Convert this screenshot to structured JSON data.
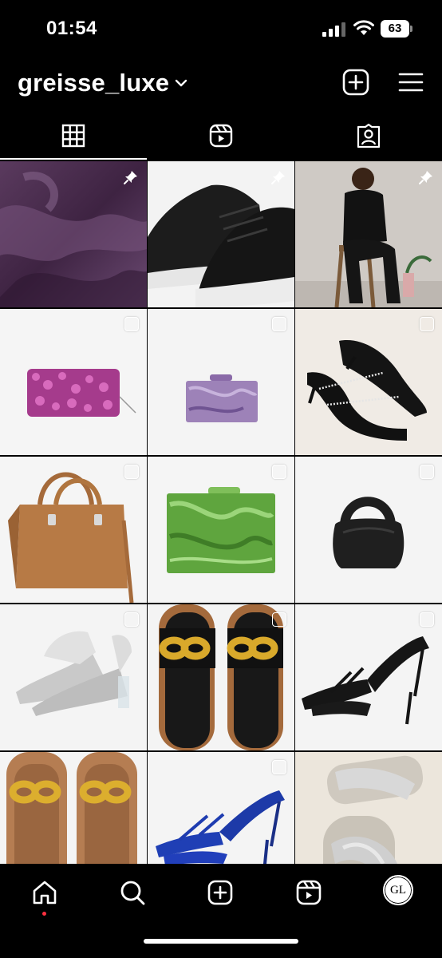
{
  "status_bar": {
    "time": "01:54",
    "battery": "63"
  },
  "header": {
    "username": "greisse_luxe",
    "icons": [
      "chevron-down-icon",
      "create-post-icon",
      "menu-icon"
    ]
  },
  "tabs": [
    {
      "name": "posts",
      "icon": "grid-icon",
      "active": true
    },
    {
      "name": "reels",
      "icon": "reels-icon",
      "active": false
    },
    {
      "name": "tagged",
      "icon": "tagged-icon",
      "active": false
    }
  ],
  "posts": [
    {
      "subject": "purple satin fabric",
      "pinned": true
    },
    {
      "subject": "black leather sneakers",
      "pinned": true
    },
    {
      "subject": "woman in black suit on stool",
      "pinned": true
    },
    {
      "subject": "pink sequin clutch",
      "pinned": false
    },
    {
      "subject": "lilac marble acrylic clutch",
      "pinned": false
    },
    {
      "subject": "black rhinestone strap mules",
      "pinned": false
    },
    {
      "subject": "tan leather tote bag",
      "pinned": false
    },
    {
      "subject": "green marble box clutch",
      "pinned": false
    },
    {
      "subject": "black round mini bag",
      "pinned": false
    },
    {
      "subject": "silver metallic pointed mules",
      "pinned": false
    },
    {
      "subject": "black slides with gold chain",
      "pinned": false
    },
    {
      "subject": "black strappy sandals",
      "pinned": false
    },
    {
      "subject": "tan slides with gold chain",
      "pinned": false
    },
    {
      "subject": "blue strappy heels",
      "pinned": false
    },
    {
      "subject": "silver woven flat sandals",
      "pinned": false
    }
  ],
  "bottom_nav": {
    "items": [
      "home-icon",
      "search-icon",
      "create-icon",
      "reels-icon",
      "profile-avatar"
    ],
    "avatar_initials": "GL",
    "notification_color": "#ff3040"
  },
  "colors": {
    "background": "#000000",
    "foreground": "#ffffff"
  }
}
